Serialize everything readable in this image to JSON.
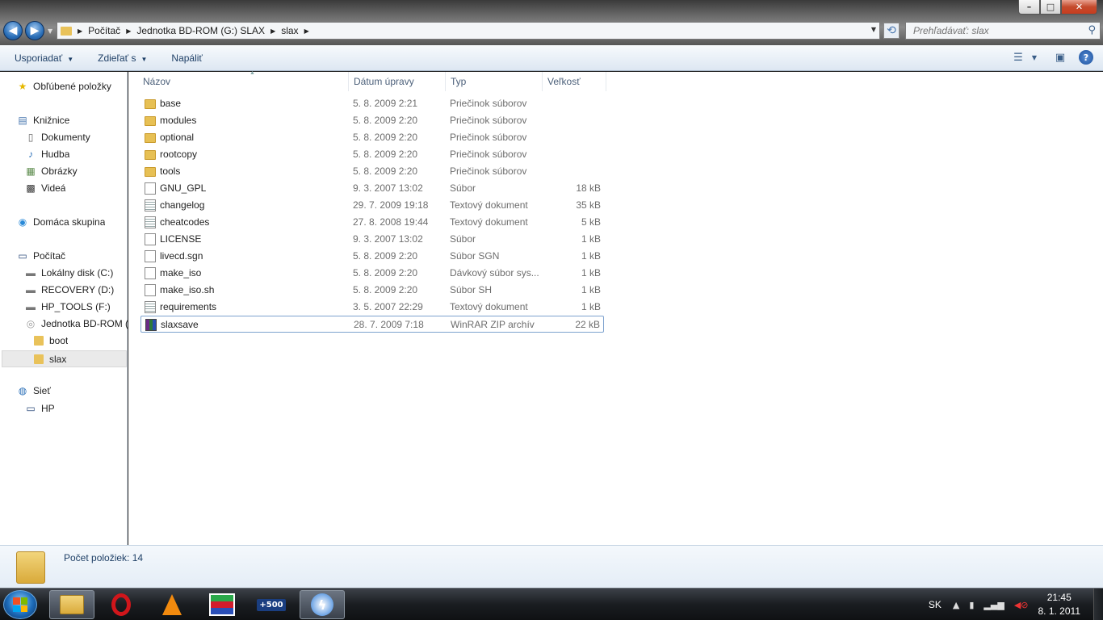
{
  "window": {
    "minimize": "–",
    "maximize": "□",
    "close": "✕"
  },
  "address": {
    "crumbs": [
      "Počítač",
      "Jednotka BD-ROM (G:) SLAX",
      "slax"
    ]
  },
  "search": {
    "placeholder": "Prehľadávať: slax"
  },
  "toolbar": {
    "organize": "Usporiadať",
    "share": "Zdieľať s",
    "burn": "Napáliť"
  },
  "sidebar": {
    "favorites": "Obľúbené položky",
    "libraries": "Knižnice",
    "documents": "Dokumenty",
    "music": "Hudba",
    "pictures": "Obrázky",
    "videos": "Videá",
    "homegroup": "Domáca skupina",
    "computer": "Počítač",
    "drive_c": "Lokálny disk (C:)",
    "drive_d": "RECOVERY (D:)",
    "drive_f": "HP_TOOLS (F:)",
    "drive_g": "Jednotka BD-ROM (G:) SLAX",
    "folder_boot": "boot",
    "folder_slax": "slax",
    "network": "Sieť",
    "network_hp": "HP"
  },
  "columns": {
    "name": "Názov",
    "date": "Dátum úpravy",
    "type": "Typ",
    "size": "Veľkosť"
  },
  "files": [
    {
      "name": "base",
      "date": "5. 8. 2009 2:21",
      "type": "Priečinok súborov",
      "size": "",
      "icon": "folder"
    },
    {
      "name": "modules",
      "date": "5. 8. 2009 2:20",
      "type": "Priečinok súborov",
      "size": "",
      "icon": "folder"
    },
    {
      "name": "optional",
      "date": "5. 8. 2009 2:20",
      "type": "Priečinok súborov",
      "size": "",
      "icon": "folder"
    },
    {
      "name": "rootcopy",
      "date": "5. 8. 2009 2:20",
      "type": "Priečinok súborov",
      "size": "",
      "icon": "folder"
    },
    {
      "name": "tools",
      "date": "5. 8. 2009 2:20",
      "type": "Priečinok súborov",
      "size": "",
      "icon": "folder"
    },
    {
      "name": "GNU_GPL",
      "date": "9. 3. 2007 13:02",
      "type": "Súbor",
      "size": "18 kB",
      "icon": "file"
    },
    {
      "name": "changelog",
      "date": "29. 7. 2009 19:18",
      "type": "Textový dokument",
      "size": "35 kB",
      "icon": "text"
    },
    {
      "name": "cheatcodes",
      "date": "27. 8. 2008 19:44",
      "type": "Textový dokument",
      "size": "5 kB",
      "icon": "text"
    },
    {
      "name": "LICENSE",
      "date": "9. 3. 2007 13:02",
      "type": "Súbor",
      "size": "1 kB",
      "icon": "file"
    },
    {
      "name": "livecd.sgn",
      "date": "5. 8. 2009 2:20",
      "type": "Súbor SGN",
      "size": "1 kB",
      "icon": "file"
    },
    {
      "name": "make_iso",
      "date": "5. 8. 2009 2:20",
      "type": "Dávkový súbor sys...",
      "size": "1 kB",
      "icon": "bat"
    },
    {
      "name": "make_iso.sh",
      "date": "5. 8. 2009 2:20",
      "type": "Súbor SH",
      "size": "1 kB",
      "icon": "file"
    },
    {
      "name": "requirements",
      "date": "3. 5. 2007 22:29",
      "type": "Textový dokument",
      "size": "1 kB",
      "icon": "text"
    },
    {
      "name": "slaxsave",
      "date": "28. 7. 2009 7:18",
      "type": "WinRAR ZIP archív",
      "size": "22 kB",
      "icon": "zip"
    }
  ],
  "selected_file": "slaxsave",
  "status": {
    "item_count": "Počet položiek: 14"
  },
  "taskbar": {
    "apps": [
      "explorer-folder-icon",
      "opera-icon",
      "vlc-icon",
      "flag-app-icon",
      "500-app-icon",
      "daemon-tools-icon"
    ],
    "badge_500": "+500",
    "language": "SK",
    "time": "21:45",
    "date": "8. 1. 2011"
  },
  "colors": {
    "accent": "#1e3f66",
    "selection_border": "#7da2ce"
  }
}
